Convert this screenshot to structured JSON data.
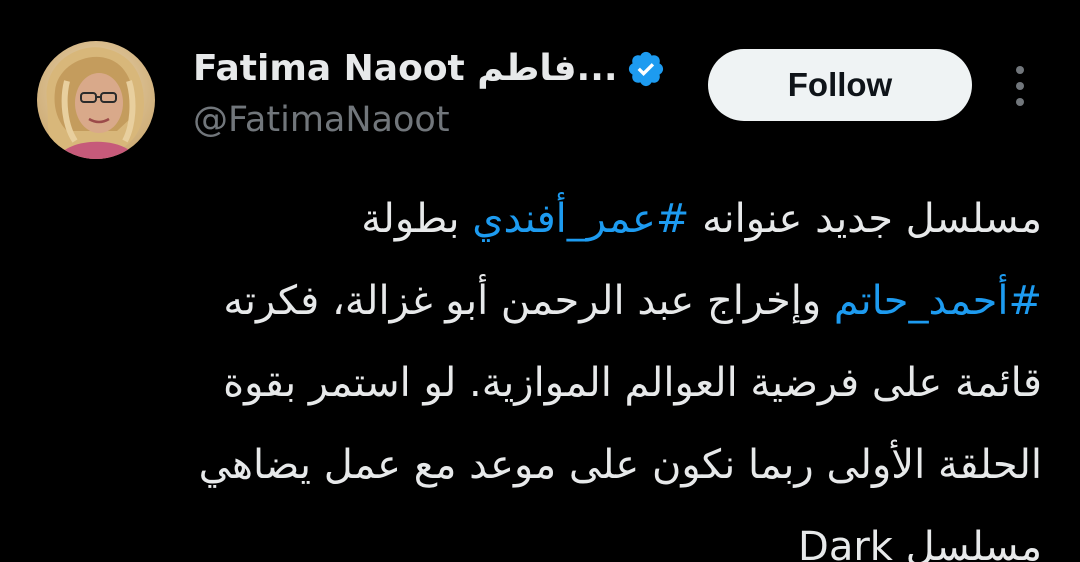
{
  "author": {
    "display_name": "Fatima Naoot فاطم...",
    "handle": "@FatimaNaoot",
    "verified": true,
    "avatar_icon": "profile-photo"
  },
  "actions": {
    "follow_label": "Follow",
    "more_icon": "more-vertical-icon"
  },
  "tweet": {
    "line1_pre": "مسلسل جديد عنوانه ",
    "hashtag1": "#عمر_أفندي",
    "line1_post": " بطولة",
    "hashtag2": "#أحمد_حاتم",
    "line2_post": " وإخراج عبد الرحمن أبو غزالة، فكرته",
    "line3": "قائمة على فرضية العوالم الموازية. لو استمر بقوة",
    "line4": "الحلقة الأولى ربما نكون على موعد مع عمل يضاهي",
    "line5": "مسلسل Dark"
  },
  "colors": {
    "background": "#000000",
    "text": "#e7e9ea",
    "secondary": "#71767b",
    "link": "#1d9bf0",
    "follow_bg": "#eff3f4",
    "verified": "#1d9bf0"
  }
}
